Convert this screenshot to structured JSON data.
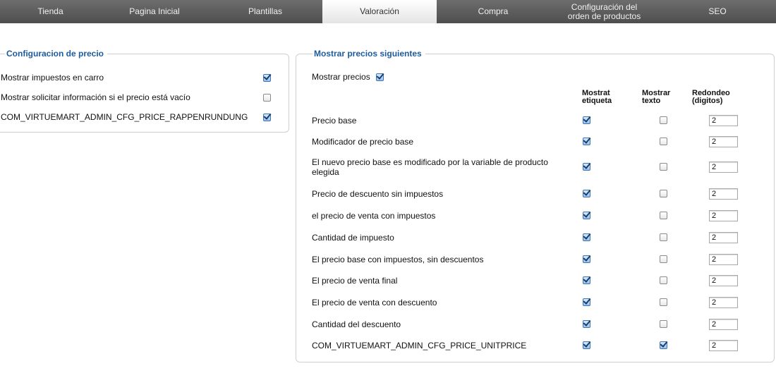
{
  "tabs": [
    {
      "label": "Tienda"
    },
    {
      "label": "Pagina Inicial"
    },
    {
      "label": "Plantillas"
    },
    {
      "label": "Valoración"
    },
    {
      "label": "Compra"
    },
    {
      "label": "Configuración del orden de productos"
    },
    {
      "label": "SEO"
    }
  ],
  "active_tab": "Valoración",
  "price_config": {
    "legend": "Configuracion de precio",
    "rows": [
      {
        "label": "Mostrar impuestos en carro",
        "checked": true
      },
      {
        "label": "Mostrar solicitar información si el precio está vacío",
        "checked": false
      },
      {
        "label": "COM_VIRTUEMART_ADMIN_CFG_PRICE_RAPPENRUNDUNG",
        "checked": true
      }
    ]
  },
  "show_prices": {
    "legend": "Mostrar precios siguientes",
    "show_prices_label": "Mostrar precios",
    "show_prices_checked": true,
    "columns": {
      "label_line1": "Mostrat",
      "label_line2": "etiqueta",
      "text_line1": "Mostrar",
      "text_line2": "texto",
      "round_line1": "Redondeo",
      "round_line2": "(digitos)"
    },
    "rows": [
      {
        "label": "Precio base",
        "show_label": true,
        "show_text": false,
        "rounding": "2"
      },
      {
        "label": "Modificador de precio base",
        "show_label": true,
        "show_text": false,
        "rounding": "2"
      },
      {
        "label": "El nuevo precio base es modificado por la variable de producto elegida",
        "show_label": true,
        "show_text": false,
        "rounding": "2"
      },
      {
        "label": "Precio de descuento sin impuestos",
        "show_label": true,
        "show_text": false,
        "rounding": "2"
      },
      {
        "label": "el precio de venta con impuestos",
        "show_label": true,
        "show_text": false,
        "rounding": "2"
      },
      {
        "label": "Cantidad de impuesto",
        "show_label": true,
        "show_text": false,
        "rounding": "2"
      },
      {
        "label": "El precio base con impuestos, sin descuentos",
        "show_label": true,
        "show_text": false,
        "rounding": "2"
      },
      {
        "label": "El precio de venta final",
        "show_label": true,
        "show_text": false,
        "rounding": "2"
      },
      {
        "label": "El precio de venta con descuento",
        "show_label": true,
        "show_text": false,
        "rounding": "2"
      },
      {
        "label": "Cantidad del descuento",
        "show_label": true,
        "show_text": false,
        "rounding": "2"
      },
      {
        "label": "COM_VIRTUEMART_ADMIN_CFG_PRICE_UNITPRICE",
        "show_label": true,
        "show_text": true,
        "rounding": "2"
      }
    ]
  }
}
